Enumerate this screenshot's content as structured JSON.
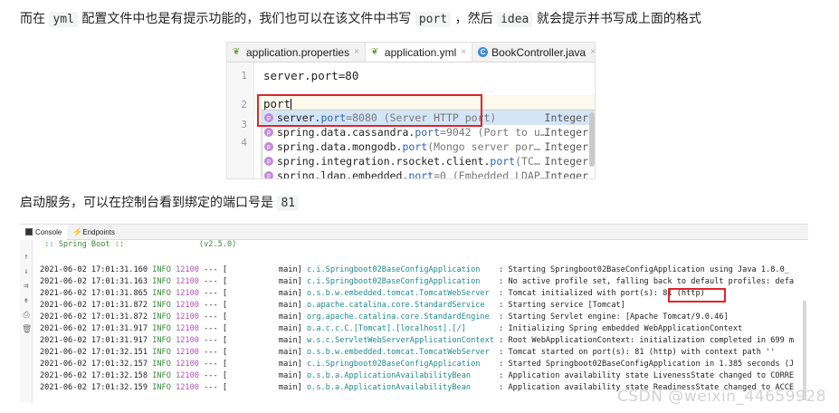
{
  "para1": {
    "t1": "而在 ",
    "c1": "yml",
    "t2": " 配置文件中也是有提示功能的，我们也可以在该文件中书写 ",
    "c2": "port",
    "t3": " ，然后 ",
    "c3": "idea",
    "t4": " 就会提示并书写成上面的格式"
  },
  "ide": {
    "tabs": [
      {
        "label": "application.properties",
        "icon": "spring-leaf-icon"
      },
      {
        "label": "application.yml",
        "icon": "spring-leaf-icon"
      },
      {
        "label": "BookController.java",
        "icon": "class-c-icon"
      }
    ],
    "line_numbers": [
      "1",
      "2",
      "3",
      "4"
    ],
    "line1": "server.port=80",
    "typed": "port",
    "suggestions": [
      {
        "base": "server.",
        "port": "port",
        "rest": "=8080 (Server HTTP port)",
        "type": "Integer"
      },
      {
        "base": "spring.data.cassandra.",
        "port": "port",
        "rest": "=9042 (Port to u…",
        "type": "Integer"
      },
      {
        "base": "spring.data.mongodb.",
        "port": "port",
        "rest": " (Mongo server por…",
        "type": "Integer"
      },
      {
        "base": "spring.integration.rsocket.client.",
        "port": "port",
        "rest": " (TC…",
        "type": "Integer"
      },
      {
        "base": "spring.ldap.embedded.",
        "port": "port",
        "rest": "=0 (Embedded LDAP…",
        "type": "Integer"
      }
    ],
    "badge": "p",
    "class_badge": "C"
  },
  "para2": {
    "text": "启动服务，可以在控制台看到绑定的端口号是 ",
    "code": "81"
  },
  "console": {
    "tabs": [
      "Console",
      "Endpoints"
    ],
    "banner": " :: Spring Boot ::                (v2.5.0)",
    "rows": [
      {
        "ts": "2021-06-02 17:01:31.160",
        "level": "INFO",
        "pid": "12100",
        "thread": "--- [           main]",
        "logger": "c.i.Springboot02BaseConfigApplication   ",
        "msg": ": Starting Springboot02BaseConfigApplication using Java 1.8.0_"
      },
      {
        "ts": "2021-06-02 17:01:31.163",
        "level": "INFO",
        "pid": "12100",
        "thread": "--- [           main]",
        "logger": "c.i.Springboot02BaseConfigApplication   ",
        "msg": ": No active profile set, falling back to default profiles: defa"
      },
      {
        "ts": "2021-06-02 17:01:31.865",
        "level": "INFO",
        "pid": "12100",
        "thread": "--- [           main]",
        "logger": "o.s.b.w.embedded.tomcat.TomcatWebServer ",
        "msg": ": Tomcat initialized with port(s): 81 (http)"
      },
      {
        "ts": "2021-06-02 17:01:31.872",
        "level": "INFO",
        "pid": "12100",
        "thread": "--- [           main]",
        "logger": "o.apache.catalina.core.StandardService  ",
        "msg": ": Starting service [Tomcat]"
      },
      {
        "ts": "2021-06-02 17:01:31.872",
        "level": "INFO",
        "pid": "12100",
        "thread": "--- [           main]",
        "logger": "org.apache.catalina.core.StandardEngine ",
        "msg": ": Starting Servlet engine: [Apache Tomcat/9.0.46]"
      },
      {
        "ts": "2021-06-02 17:01:31.917",
        "level": "INFO",
        "pid": "12100",
        "thread": "--- [           main]",
        "logger": "o.a.c.c.C.[Tomcat].[localhost].[/]      ",
        "msg": ": Initializing Spring embedded WebApplicationContext"
      },
      {
        "ts": "2021-06-02 17:01:31.917",
        "level": "INFO",
        "pid": "12100",
        "thread": "--- [           main]",
        "logger": "w.s.c.ServletWebServerApplicationContext",
        "msg": ": Root WebApplicationContext: initialization completed in 699 m"
      },
      {
        "ts": "2021-06-02 17:01:32.151",
        "level": "INFO",
        "pid": "12100",
        "thread": "--- [           main]",
        "logger": "o.s.b.w.embedded.tomcat.TomcatWebServer ",
        "msg": ": Tomcat started on port(s): 81 (http) with context path ''"
      },
      {
        "ts": "2021-06-02 17:01:32.157",
        "level": "INFO",
        "pid": "12100",
        "thread": "--- [           main]",
        "logger": "c.i.Springboot02BaseConfigApplication   ",
        "msg": ": Started Springboot02BaseConfigApplication in 1.385 seconds (J"
      },
      {
        "ts": "2021-06-02 17:01:32.158",
        "level": "INFO",
        "pid": "12100",
        "thread": "--- [           main]",
        "logger": "o.s.b.a.ApplicationAvailabilityBean     ",
        "msg": ": Application availability state LivenessState changed to CORRE"
      },
      {
        "ts": "2021-06-02 17:01:32.159",
        "level": "INFO",
        "pid": "12100",
        "thread": "--- [           main]",
        "logger": "o.s.b.a.ApplicationAvailabilityBean     ",
        "msg": ": Application availability state ReadinessState changed to ACCE"
      }
    ]
  },
  "watermark": "CSDN @weixin_44659928",
  "colors": {
    "highlight_box": "#e0242b",
    "port_keyword": "#2f5fb0",
    "log_info": "#3a8c3a",
    "log_pid": "#b052b0",
    "log_logger": "#1f8a8a"
  }
}
